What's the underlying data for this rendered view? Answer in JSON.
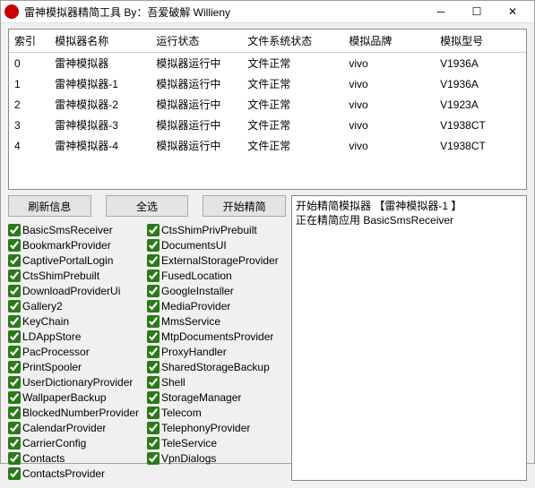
{
  "title": "雷神模拟器精简工具 By：吾爱破解 Willieny",
  "columns": [
    "索引",
    "模拟器名称",
    "运行状态",
    "文件系统状态",
    "模拟品牌",
    "模拟型号"
  ],
  "rows": [
    {
      "idx": "0",
      "name": "雷神模拟器",
      "run": "模拟器运行中",
      "fs": "文件正常",
      "brand": "vivo",
      "model": "V1936A"
    },
    {
      "idx": "1",
      "name": "雷神模拟器-1",
      "run": "模拟器运行中",
      "fs": "文件正常",
      "brand": "vivo",
      "model": "V1936A"
    },
    {
      "idx": "2",
      "name": "雷神模拟器-2",
      "run": "模拟器运行中",
      "fs": "文件正常",
      "brand": "vivo",
      "model": "V1923A"
    },
    {
      "idx": "3",
      "name": "雷神模拟器-3",
      "run": "模拟器运行中",
      "fs": "文件正常",
      "brand": "vivo",
      "model": "V1938CT"
    },
    {
      "idx": "4",
      "name": "雷神模拟器-4",
      "run": "模拟器运行中",
      "fs": "文件正常",
      "brand": "vivo",
      "model": "V1938CT"
    }
  ],
  "buttons": {
    "refresh": "刷新信息",
    "selectall": "全选",
    "start": "开始精简"
  },
  "checks_left": [
    "BasicSmsReceiver",
    "BookmarkProvider",
    "CaptivePortalLogin",
    "CtsShimPrebuilt",
    "DownloadProviderUi",
    "Gallery2",
    "KeyChain",
    "LDAppStore",
    "PacProcessor",
    "PrintSpooler",
    "UserDictionaryProvider",
    "WallpaperBackup",
    "BlockedNumberProvider",
    "CalendarProvider",
    "CarrierConfig",
    "Contacts",
    "ContactsProvider"
  ],
  "checks_right": [
    "CtsShimPrivPrebuilt",
    "DocumentsUI",
    "ExternalStorageProvider",
    "FusedLocation",
    "GoogleInstaller",
    "MediaProvider",
    "MmsService",
    "MtpDocumentsProvider",
    "ProxyHandler",
    "SharedStorageBackup",
    "Shell",
    "StorageManager",
    "Telecom",
    "TelephonyProvider",
    "TeleService",
    "VpnDialogs"
  ],
  "log": "开始精简模拟器 【雷神模拟器-1 】\n正在精简应用 BasicSmsReceiver"
}
